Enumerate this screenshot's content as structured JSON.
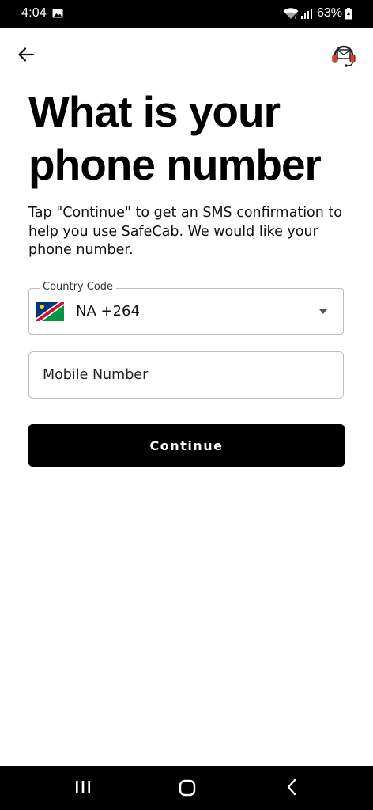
{
  "status_bar": {
    "time": "4:04",
    "battery": "63%",
    "icons": [
      "image-icon",
      "wifi-icon",
      "signal-icon",
      "battery-icon"
    ]
  },
  "header": {
    "back_icon": "arrow-left-icon",
    "support_icon": "headset-support-icon"
  },
  "main": {
    "title": "What is your phone number",
    "subtitle": "Tap \"Continue\" to get an SMS confirmation to help you use SafeCab. We would like your phone number.",
    "country_code": {
      "label": "Country Code",
      "value": "NA +264",
      "flag_icon": "namibia-flag-icon"
    },
    "mobile_number": {
      "placeholder": "Mobile Number",
      "value": ""
    },
    "continue_label": "Continue"
  },
  "nav_bar": {
    "icons": [
      "recents-icon",
      "home-icon",
      "back-icon"
    ]
  },
  "colors": {
    "primary_button": "#000000",
    "button_text": "#ffffff",
    "field_border": "#bdbdbd",
    "support_icon_red": "#e53935"
  }
}
